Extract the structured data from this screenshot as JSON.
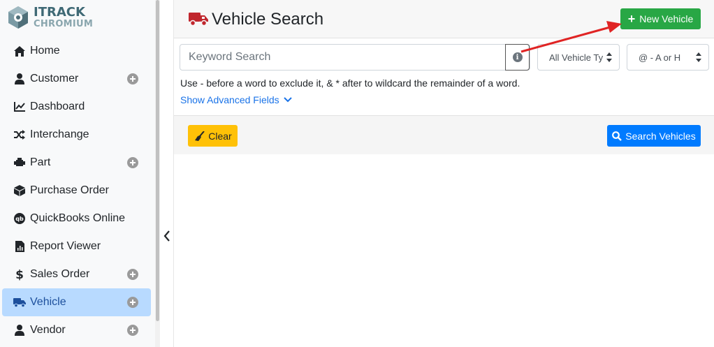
{
  "logo": {
    "line1": "ITRACK",
    "line2": "CHROMIUM"
  },
  "sidebar": {
    "items": [
      {
        "label": "Home",
        "icon": "home-icon",
        "expandable": false,
        "active": false
      },
      {
        "label": "Customer",
        "icon": "user-icon",
        "expandable": true,
        "active": false
      },
      {
        "label": "Dashboard",
        "icon": "chart-line-icon",
        "expandable": false,
        "active": false
      },
      {
        "label": "Interchange",
        "icon": "shuffle-icon",
        "expandable": false,
        "active": false
      },
      {
        "label": "Part",
        "icon": "engine-icon",
        "expandable": true,
        "active": false
      },
      {
        "label": "Purchase Order",
        "icon": "box-icon",
        "expandable": false,
        "active": false
      },
      {
        "label": "QuickBooks Online",
        "icon": "quickbooks-icon",
        "expandable": false,
        "active": false
      },
      {
        "label": "Report Viewer",
        "icon": "report-icon",
        "expandable": false,
        "active": false
      },
      {
        "label": "Sales Order",
        "icon": "dollar-icon",
        "expandable": true,
        "active": false
      },
      {
        "label": "Vehicle",
        "icon": "truck-icon",
        "expandable": true,
        "active": true
      },
      {
        "label": "Vendor",
        "icon": "user-icon",
        "expandable": true,
        "active": false
      }
    ]
  },
  "header": {
    "title": "Vehicle Search",
    "new_button": "New Vehicle"
  },
  "search": {
    "placeholder": "Keyword Search",
    "vehicle_type_value": "All Vehicle Ty",
    "sort_value": "@ - A or H",
    "hint": "Use - before a word to exclude it, & * after to wildcard the remainder of a word.",
    "advanced_link": "Show Advanced Fields"
  },
  "toolbar": {
    "clear_label": "Clear",
    "search_label": "Search Vehicles"
  },
  "colors": {
    "accent_green": "#28a745",
    "accent_blue": "#007bff",
    "accent_yellow": "#ffc107",
    "active_nav": "#b8daff",
    "truck_red": "#c0262d",
    "annotation_arrow": "#e02424"
  }
}
